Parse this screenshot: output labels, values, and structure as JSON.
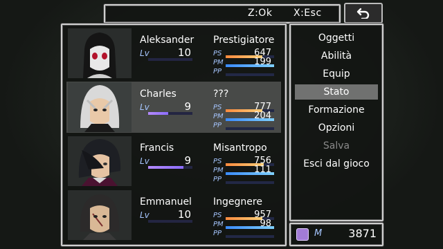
{
  "help": {
    "confirm_hint": "Z:Ok",
    "cancel_hint": "X:Esc"
  },
  "back_button_icon": "return-arrow-icon",
  "party": [
    {
      "name": "Aleksander",
      "level_label": "Lv",
      "level": "10",
      "level_progress": 0.0,
      "class": "Prestigiatore",
      "hp_label": "PS",
      "hp": "647",
      "hp_fraction": 0.75,
      "mp_label": "PM",
      "mp": "199",
      "mp_fraction": 1.0,
      "pp_label": "PP",
      "pp_fraction": 0.0,
      "selected": false
    },
    {
      "name": "Charles",
      "level_label": "Lv",
      "level": "9",
      "level_progress": 0.45,
      "class": "???",
      "hp_label": "PS",
      "hp": "777",
      "hp_fraction": 0.75,
      "mp_label": "PM",
      "mp": "204",
      "mp_fraction": 1.0,
      "pp_label": "PP",
      "pp_fraction": 0.0,
      "selected": true
    },
    {
      "name": "Francis",
      "level_label": "Lv",
      "level": "9",
      "level_progress": 0.8,
      "class": "Misantropo",
      "hp_label": "PS",
      "hp": "756",
      "hp_fraction": 0.78,
      "mp_label": "PM",
      "mp": "111",
      "mp_fraction": 1.0,
      "pp_label": "PP",
      "pp_fraction": 0.0,
      "selected": false
    },
    {
      "name": "Emmanuel",
      "level_label": "Lv",
      "level": "10",
      "level_progress": 0.0,
      "class": "Ingegnere",
      "hp_label": "PS",
      "hp": "957",
      "hp_fraction": 0.76,
      "mp_label": "PM",
      "mp": "98",
      "mp_fraction": 1.0,
      "pp_label": "PP",
      "pp_fraction": 0.0,
      "selected": false
    }
  ],
  "menu": [
    {
      "label": "Oggetti",
      "state": "normal"
    },
    {
      "label": "Abilità",
      "state": "normal"
    },
    {
      "label": "Equip",
      "state": "normal"
    },
    {
      "label": "Stato",
      "state": "selected"
    },
    {
      "label": "Formazione",
      "state": "normal"
    },
    {
      "label": "Opzioni",
      "state": "normal"
    },
    {
      "label": "Salva",
      "state": "disabled"
    },
    {
      "label": "Esci dal gioco",
      "state": "normal"
    }
  ],
  "gold": {
    "icon": "currency-gem-icon",
    "unit": "M",
    "amount": "3871"
  },
  "colors": {
    "hp_bar": "#ff9a4a",
    "mp_bar": "#4aa0ff",
    "level_bar": "#9a78ff",
    "accent_label": "#a6c6ff"
  }
}
